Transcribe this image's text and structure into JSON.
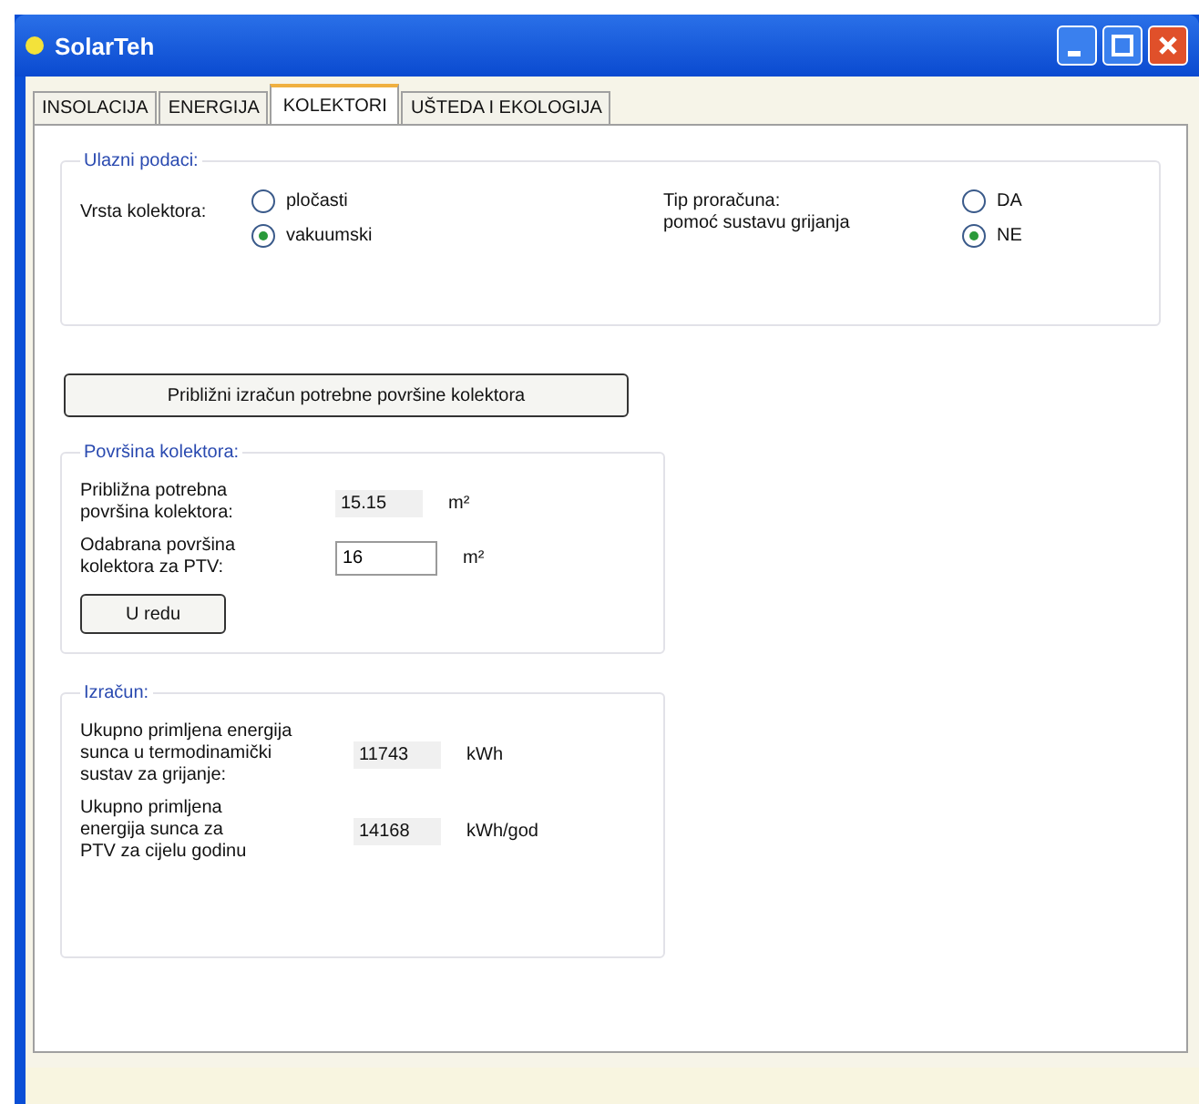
{
  "window": {
    "title": "SolarTeh"
  },
  "tabs": [
    {
      "label": "INSOLACIJA",
      "selected": false
    },
    {
      "label": "ENERGIJA",
      "selected": false
    },
    {
      "label": "KOLEKTORI",
      "selected": true
    },
    {
      "label": "UŠTEDA I EKOLOGIJA",
      "selected": false
    }
  ],
  "input_group": {
    "title": "Ulazni podaci:",
    "radio_groups": [
      {
        "label": "Vrsta kolektora:",
        "options": [
          {
            "label": "pločasti",
            "selected": false
          },
          {
            "label": "vakuumski",
            "selected": true
          }
        ]
      },
      {
        "label": "Tip proračuna:\npomoć sustavu grijanja",
        "options": [
          {
            "label": "DA",
            "selected": false
          },
          {
            "label": "NE",
            "selected": true
          }
        ]
      }
    ]
  },
  "calc_button": "Približni izračun potrebne površine kolektora",
  "area_group": {
    "title": "Površina kolektora:",
    "rows": [
      {
        "kind": "readout",
        "label": "Približna potrebna\npovršina kolektora:",
        "value": "15.15",
        "unit": "m²"
      },
      {
        "kind": "input",
        "label": "Odabrana površina\nkolektora za PTV:",
        "value": "16",
        "unit": "m²"
      }
    ],
    "ok_button": "U redu"
  },
  "result_group": {
    "title": "Izračun:",
    "rows": [
      {
        "label": "Ukupno primljena energija\nsunca u termodinamički\nsustav za grijanje:",
        "value": "11743",
        "unit": "kWh"
      },
      {
        "label": "Ukupno primljena\nenergija sunca za\nPTV za cijelu godinu",
        "value": "14168",
        "unit": "kWh/god"
      }
    ]
  }
}
